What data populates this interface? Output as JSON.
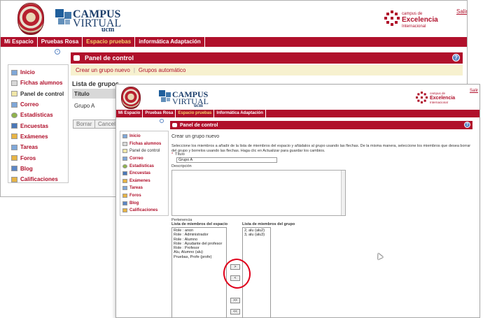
{
  "header": {
    "campus_title": "CAMPUS",
    "virtual_title": "VIRTUAL",
    "ucm_label": "ucm",
    "cei_small": "campus de",
    "cei_big": "Excelencia",
    "cei_sub": "Internacional",
    "logout": "Salir"
  },
  "nav": [
    {
      "label": "Mi Espacio"
    },
    {
      "label": "Pruebas Rosa"
    },
    {
      "label": "Espacio pruebas"
    },
    {
      "label": "informática Adaptación"
    }
  ],
  "nav_front": [
    {
      "label": "Mi Espacio"
    },
    {
      "label": "Pruebas Rosa"
    },
    {
      "label": "Espacio pruebas"
    },
    {
      "label": "Informática Adaptación"
    }
  ],
  "sidebar": [
    {
      "label": "Inicio"
    },
    {
      "label": "Fichas alumnos"
    },
    {
      "label": "Panel de control"
    },
    {
      "label": "Correo"
    },
    {
      "label": "Estadísticas"
    },
    {
      "label": "Encuestas"
    },
    {
      "label": "Exámenes"
    },
    {
      "label": "Tareas"
    },
    {
      "label": "Foros"
    },
    {
      "label": "Blog"
    },
    {
      "label": "Calificaciones"
    }
  ],
  "panel_title": "Panel de control",
  "help_label": "?",
  "back_window": {
    "tabs": [
      "Crear un grupo nuevo",
      "Grupos automático"
    ],
    "tab_separator": "|",
    "list_title": "Lista de grupos",
    "column_header": "Título",
    "rows": [
      "Grupo A"
    ],
    "delete_button": "Borrar",
    "cancel_button": "Cancela"
  },
  "form": {
    "heading": "Crear un grupo nuevo",
    "instructions": "Seleccione los miembros a añadir de la lista de miembros del espacio y añádalos al grupo usando las flechas. De la misma manera, seleccione los miembros que desea borrar del grupo y borrelos usando las flechas. Haga clic en Actualizar para guardar los cambios.",
    "required_mark": "*",
    "title_label": "Título",
    "title_value": "Grupo A",
    "description_label": "Descripción",
    "membership_label": "Pertenencia",
    "space_members_label": "Lista de miembros del espacio",
    "group_members_label": "Lista de miembros del grupo",
    "space_members": [
      "Role : anon",
      "Role : Administrador",
      "Role : Alumno",
      "Role : Ayudante del profesor",
      "Role : Profesor",
      "Alu, Alumno (alu)",
      "Pruebas, Profe (profe)"
    ],
    "group_members": [
      "2, alu (alu2)",
      "3, alu (alu3)"
    ],
    "add_one": ">",
    "remove_one": "<",
    "add_all": ">>",
    "remove_all": "<<"
  }
}
